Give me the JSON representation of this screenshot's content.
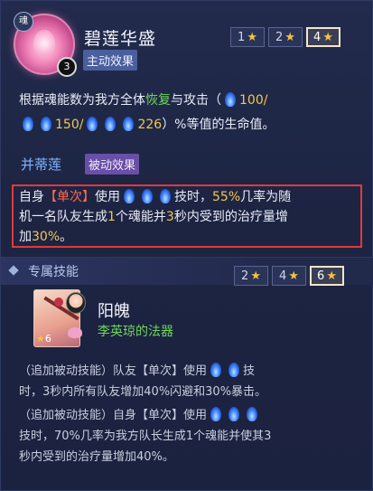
{
  "skill": {
    "icon_name": "lotus-icon",
    "soul_badge": "魂",
    "level_badge": "3",
    "name": "碧莲华盛",
    "type_tag": "主动效果",
    "star_buttons": [
      {
        "label": "1",
        "selected": false
      },
      {
        "label": "2",
        "selected": false
      },
      {
        "label": "4",
        "selected": true
      }
    ],
    "active_desc": {
      "l1_a": "根据魂能数为我方全体",
      "l1_heal": "恢复",
      "l1_b": "与攻击（",
      "v1": "100/",
      "v2": "150/",
      "v3": "226",
      "l2_end": "）%等值的生命值。"
    }
  },
  "passive": {
    "title": "并蒂莲",
    "type_tag": "被动效果",
    "l1_a": "自身",
    "l1_single": "【单次】",
    "l1_b": "使用",
    "l1_c": "技时，",
    "l1_pct": "55%",
    "l1_d": "几率为随",
    "l2_a": "机一名队友生成",
    "l2_one": "1",
    "l2_b": "个魂能并",
    "l2_three": "3",
    "l2_c": "秒内受到的治疗量增",
    "l3_a": "加",
    "l3_pct": "30%",
    "l3_b": "。"
  },
  "exclusive": {
    "header": "专属技能",
    "star_buttons": [
      {
        "label": "2",
        "selected": false
      },
      {
        "label": "4",
        "selected": false
      },
      {
        "label": "6",
        "selected": true
      }
    ],
    "weapon_star": "6",
    "weapon_name": "阳魄",
    "weapon_owner": "李英琼的法器",
    "desc1_a": "（追加被动技能）队友【单次】使用",
    "desc1_b": "技",
    "desc1_c": "时，3秒内所有队友增加40%闪避和30%暴击。",
    "desc2_a": "（追加被动技能）自身【单次】使用",
    "desc2_b": "技时，70%几率为我方队长生成1个魂能并使其3",
    "desc2_c": "秒内受到的治疗量增加40%。"
  },
  "colors": {
    "heal_green": "#6fd65a",
    "value_yellow": "#f0c850",
    "passive_blue": "#7aa9ff",
    "single_red": "#ff6b57",
    "highlight_box": "#e03a3a",
    "star_gold": "#f3c341"
  }
}
